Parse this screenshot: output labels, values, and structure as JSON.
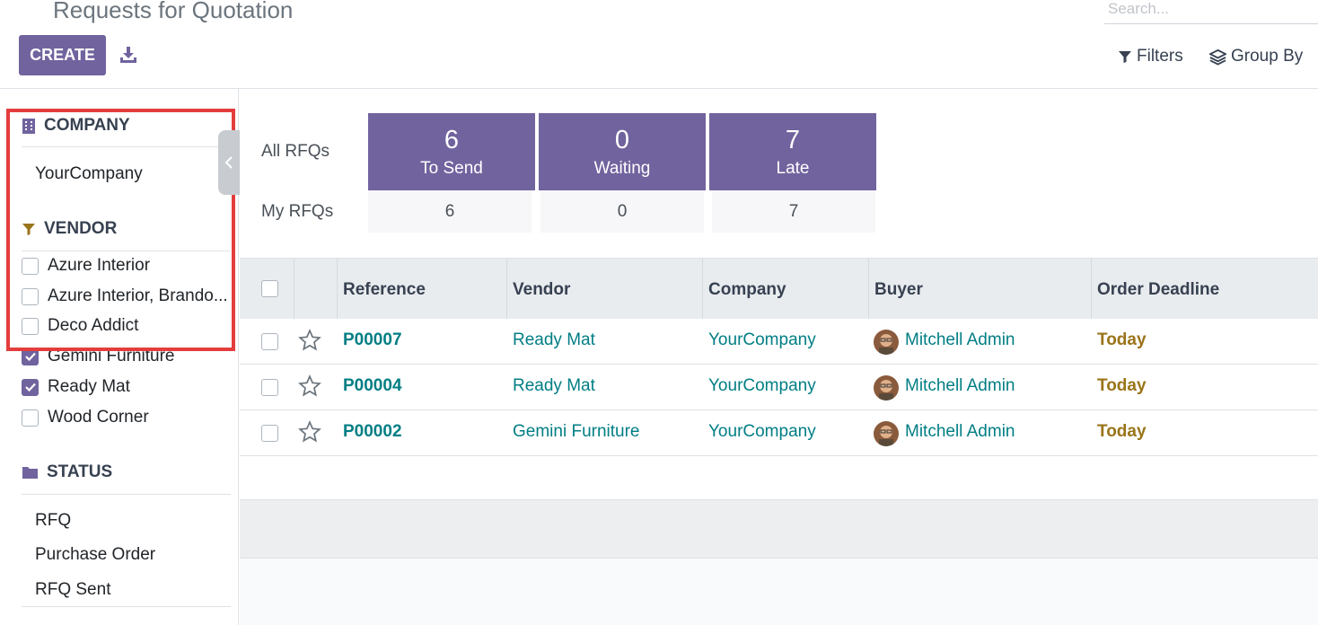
{
  "page": {
    "title": "Requests for Quotation",
    "search_placeholder": "Search..."
  },
  "toolbar": {
    "create_label": "CREATE",
    "filters_label": "Filters",
    "group_by_label": "Group By"
  },
  "colors": {
    "primary": "#71639e",
    "link": "#017e84",
    "deadline": "#9a7419",
    "highlight": "#e43d3d"
  },
  "sidebar": {
    "company": {
      "title": "COMPANY",
      "icon": "building-icon",
      "items": [
        "YourCompany"
      ]
    },
    "vendor": {
      "title": "VENDOR",
      "icon": "filter-icon",
      "items": [
        {
          "label": "Azure Interior",
          "checked": false
        },
        {
          "label": "Azure Interior, Brando...",
          "checked": false
        },
        {
          "label": "Deco Addict",
          "checked": false
        },
        {
          "label": "Gemini Furniture",
          "checked": true
        },
        {
          "label": "Ready Mat",
          "checked": true
        },
        {
          "label": "Wood Corner",
          "checked": false
        }
      ]
    },
    "status": {
      "title": "STATUS",
      "icon": "folder-icon",
      "items": [
        "RFQ",
        "Purchase Order",
        "RFQ Sent"
      ]
    }
  },
  "dashboard": {
    "all_label": "All RFQs",
    "my_label": "My RFQs",
    "tiles": [
      {
        "count": "6",
        "label": "To Send",
        "my": "6"
      },
      {
        "count": "0",
        "label": "Waiting",
        "my": "0"
      },
      {
        "count": "7",
        "label": "Late",
        "my": "7"
      }
    ]
  },
  "table": {
    "columns": [
      "Reference",
      "Vendor",
      "Company",
      "Buyer",
      "Order Deadline"
    ],
    "rows": [
      {
        "reference": "P00007",
        "vendor": "Ready Mat",
        "company": "YourCompany",
        "buyer": "Mitchell Admin",
        "deadline": "Today"
      },
      {
        "reference": "P00004",
        "vendor": "Ready Mat",
        "company": "YourCompany",
        "buyer": "Mitchell Admin",
        "deadline": "Today"
      },
      {
        "reference": "P00002",
        "vendor": "Gemini Furniture",
        "company": "YourCompany",
        "buyer": "Mitchell Admin",
        "deadline": "Today"
      }
    ]
  }
}
